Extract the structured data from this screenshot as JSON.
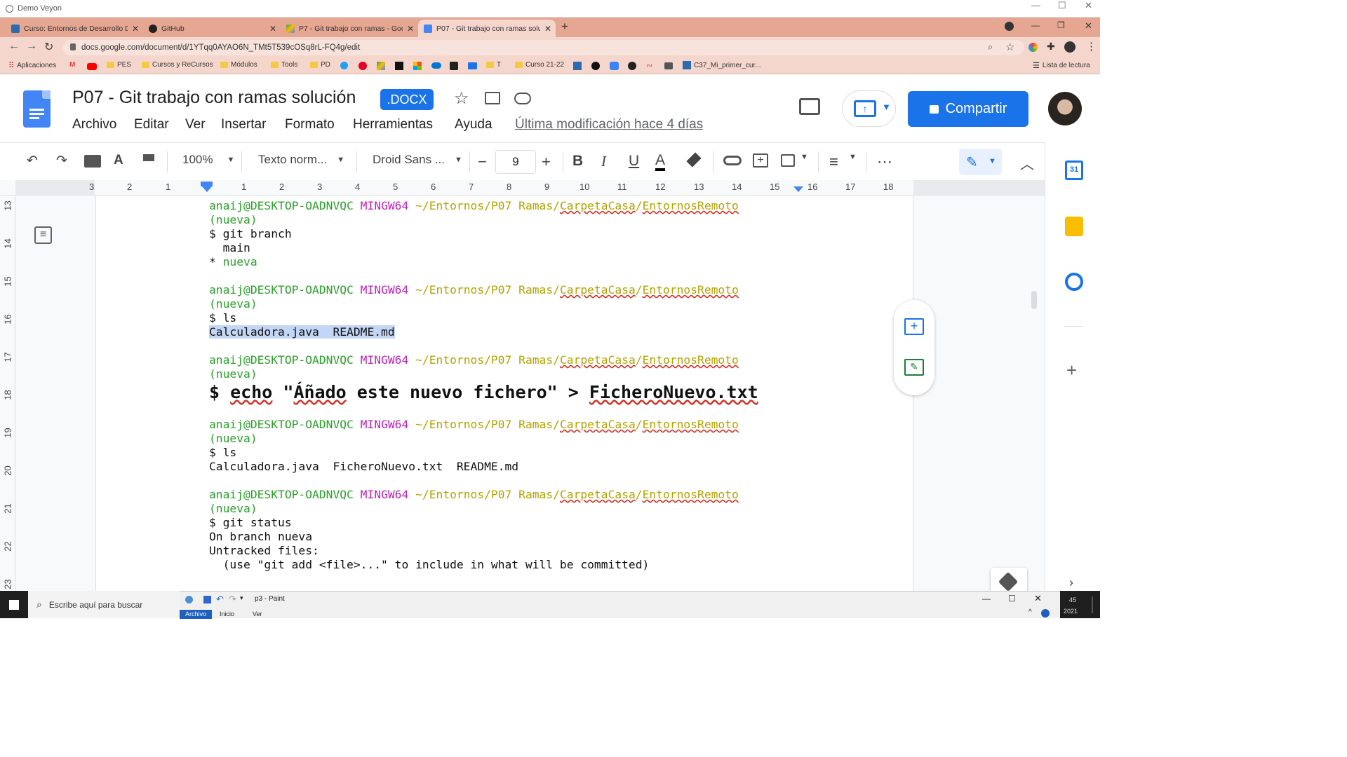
{
  "remote_window": {
    "title": "Demo Veyon"
  },
  "tabs": [
    {
      "label": "Curso: Entornos de Desarrollo DA",
      "favicon": "moodle-icon"
    },
    {
      "label": "GitHub",
      "favicon": "github-icon"
    },
    {
      "label": "P7 - Git trabajo con ramas - Goo",
      "favicon": "drive-icon"
    },
    {
      "label": "P07 - Git trabajo con ramas soluc",
      "favicon": "docs-icon",
      "active": true
    }
  ],
  "address": {
    "url": "docs.google.com/document/d/1YTqq0AYAO6N_TMt5T539cOSq8rL-FQ4g/edit"
  },
  "bookmarks": [
    "Aplicaciones",
    "PES",
    "Cursos y ReCursos",
    "Módulos",
    "Tools",
    "PD",
    "T",
    "Curso 21-22",
    "C37_Mi_primer_cur..."
  ],
  "bookmarks_reading_list": "Lista de lectura",
  "doc": {
    "title": "P07 - Git trabajo con ramas solución",
    "badge": ".DOCX",
    "menus": [
      "Archivo",
      "Editar",
      "Ver",
      "Insertar",
      "Formato",
      "Herramientas",
      "Ayuda"
    ],
    "last_modified": "Última modificación hace 4 días",
    "share_label": "Compartir"
  },
  "toolbar": {
    "zoom": "100%",
    "style": "Texto norm...",
    "font": "Droid Sans ...",
    "font_size": "9"
  },
  "ruler": {
    "h_numbers": [
      "3",
      "2",
      "1",
      "1",
      "2",
      "3",
      "4",
      "5",
      "6",
      "7",
      "8",
      "9",
      "10",
      "11",
      "12",
      "13",
      "14",
      "15",
      "16",
      "17",
      "18"
    ],
    "v_numbers": [
      "13",
      "14",
      "15",
      "16",
      "17",
      "18",
      "19",
      "20",
      "21",
      "22",
      "23"
    ]
  },
  "terminal": {
    "user": "anaij@DESKTOP-OADNVQC",
    "shell": "MINGW64",
    "path_prefix": "~/Entornos/P07 Ramas/",
    "path_folder1": "CarpetaCasa",
    "path_sep": "/",
    "path_folder2": "EntornosRemoto",
    "branch": "(nueva)",
    "cmd_branch": "$ git branch",
    "out_main": "  main",
    "out_star": "* ",
    "out_nueva": "nueva",
    "cmd_ls": "$ ls",
    "out_ls1": "Calculadora.java  README.md",
    "echo_prefix": "$ ",
    "echo_word": "echo",
    "echo_q1": " \"",
    "echo_anado": "Áñado",
    "echo_rest": " este nuevo fichero\" > ",
    "echo_file": "FicheroNuevo.txt",
    "out_ls2": "Calculadora.java  FicheroNuevo.txt  README.md",
    "cmd_status": "$ git status",
    "status1": "On branch nueva",
    "status2": "Untracked files:",
    "status3": "  (use \"git add <file>...\" to include in what will be committed)"
  },
  "taskbar": {
    "search_placeholder": "Escribe aquí para buscar",
    "paint_title": "p3 - Paint",
    "paint_tabs": [
      "Archivo",
      "Inicio",
      "Ver"
    ],
    "clock_year": "2021",
    "clock_min": "45"
  },
  "colors": {
    "tabstrip": "#e5a692",
    "accent": "#1a73e8",
    "term_green": "#2aa22a",
    "term_magenta": "#c21ec2",
    "term_yellow": "#b5a300"
  }
}
